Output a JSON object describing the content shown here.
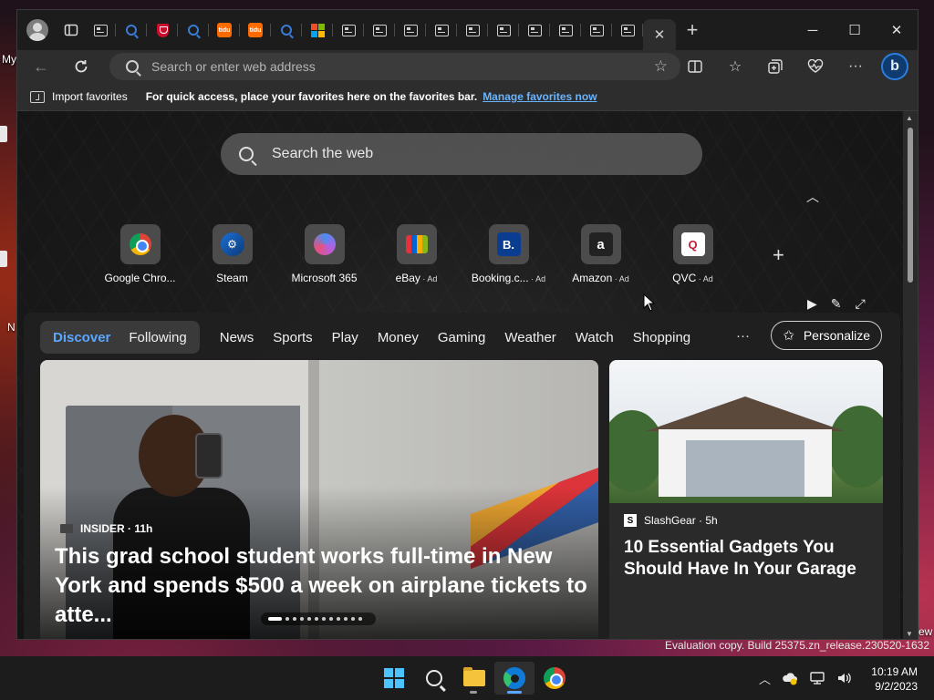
{
  "desktop": {
    "label_my": "My",
    "label_n": "N",
    "label_ew": "ew",
    "eval_text": "Evaluation copy. Build 25375.zn_release.230520-1632"
  },
  "tabs": [
    {
      "icon": "news-icon"
    },
    {
      "icon": "search-icon"
    },
    {
      "icon": "shield-icon"
    },
    {
      "icon": "search-icon"
    },
    {
      "icon": "orange-app-icon",
      "text": "tidu"
    },
    {
      "icon": "orange-app-icon",
      "text": "tidu"
    },
    {
      "icon": "search-icon"
    },
    {
      "icon": "microsoft-icon"
    },
    {
      "icon": "news-icon"
    },
    {
      "icon": "news-icon"
    },
    {
      "icon": "news-icon"
    },
    {
      "icon": "news-icon"
    },
    {
      "icon": "news-icon"
    },
    {
      "icon": "news-icon"
    },
    {
      "icon": "news-icon"
    },
    {
      "icon": "news-icon"
    },
    {
      "icon": "news-icon"
    },
    {
      "icon": "news-icon"
    }
  ],
  "address_bar": {
    "placeholder": "Search or enter web address"
  },
  "favorites_bar": {
    "import_label": "Import favorites",
    "message": "For quick access, place your favorites here on the favorites bar.",
    "link": "Manage favorites now"
  },
  "newtab": {
    "search_placeholder": "Search the web",
    "quick_links": [
      {
        "label": "Google Chro...",
        "ad": "",
        "icon": "chrome-icon"
      },
      {
        "label": "Steam",
        "ad": "",
        "icon": "steam-icon"
      },
      {
        "label": "Microsoft 365",
        "ad": "",
        "icon": "microsoft-365-icon"
      },
      {
        "label": "eBay",
        "ad": "Ad",
        "icon": "ebay-icon"
      },
      {
        "label": "Booking.c...",
        "ad": "Ad",
        "icon": "booking-icon",
        "glyph": "B."
      },
      {
        "label": "Amazon",
        "ad": "Ad",
        "icon": "amazon-icon",
        "glyph": "a"
      },
      {
        "label": "QVC",
        "ad": "Ad",
        "icon": "qvc-icon",
        "glyph": "Q"
      }
    ]
  },
  "feed": {
    "tabs": [
      {
        "label": "Discover",
        "active": true
      },
      {
        "label": "Following",
        "active": false
      }
    ],
    "categories": [
      "News",
      "Sports",
      "Play",
      "Money",
      "Gaming",
      "Weather",
      "Watch",
      "Shopping"
    ],
    "more_label": "···",
    "personalize_label": "Personalize",
    "hero": {
      "source": "INSIDER · 11h",
      "headline": "This grad school student works full-time in New York and spends $500 a week on airplane tickets to atte..."
    },
    "side_card": {
      "source": "SlashGear · 5h",
      "headline": "10 Essential Gadgets You Should Have In Your Garage"
    },
    "carousel": {
      "count": 12,
      "active": 0
    }
  },
  "taskbar": {
    "apps": [
      "start-icon",
      "search-icon",
      "file-explorer-icon",
      "edge-icon",
      "chrome-icon"
    ],
    "time": "10:19 AM",
    "date": "9/2/2023"
  }
}
